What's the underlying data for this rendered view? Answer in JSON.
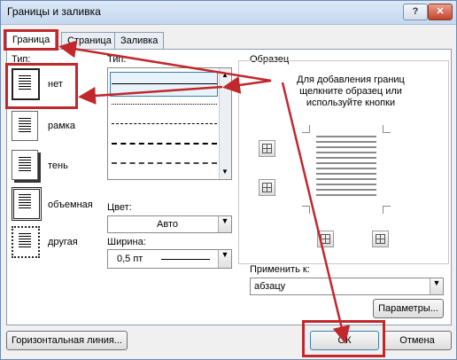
{
  "window": {
    "title": "Границы и заливка",
    "help": "?",
    "close": "✕"
  },
  "tabs": [
    "Граница",
    "Страница",
    "Заливка"
  ],
  "left": {
    "type_label": "Тип:",
    "settings": [
      {
        "label": "нет",
        "icon": "border-none-icon"
      },
      {
        "label": "рамка",
        "icon": "border-box-icon"
      },
      {
        "label": "тень",
        "icon": "border-shadow-icon"
      },
      {
        "label": "объемная",
        "icon": "border-3d-icon"
      },
      {
        "label": "другая",
        "icon": "border-custom-icon"
      }
    ]
  },
  "middle": {
    "type_label": "Тип:",
    "color_label": "Цвет:",
    "color_value": "Авто",
    "width_label": "Ширина:",
    "width_value": "0,5 пт"
  },
  "preview": {
    "label": "Образец",
    "hint": [
      "Для добавления границ",
      "щелкните образец или",
      "используйте кнопки"
    ],
    "apply_label": "Применить к:",
    "apply_value": "абзацу",
    "params_button": "Параметры..."
  },
  "footer": {
    "hline_button": "Горизонтальная линия...",
    "ok_button": "ОК",
    "cancel_button": "Отмена"
  },
  "accent_color": "#c0282c"
}
